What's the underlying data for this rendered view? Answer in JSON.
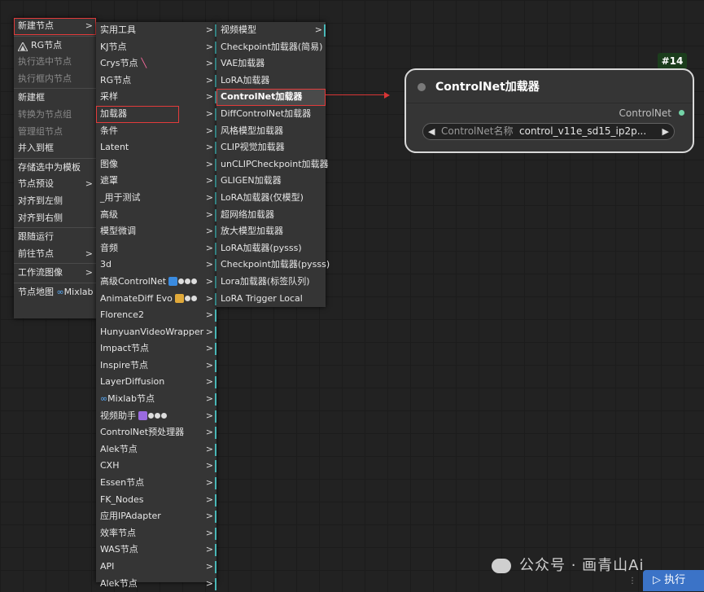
{
  "menu1": {
    "items": [
      {
        "label": "新建节点",
        "disabled": false,
        "arrow": true
      },
      {
        "label": "RG节点",
        "disabled": false,
        "arrow": false,
        "icon": "rg-triangle-icon"
      },
      {
        "label": "执行选中节点",
        "disabled": true,
        "arrow": false
      },
      {
        "label": "执行框内节点",
        "disabled": true,
        "arrow": false
      },
      {
        "label": "新建框",
        "disabled": false,
        "arrow": false
      },
      {
        "label": "转换为节点组",
        "disabled": true,
        "arrow": false
      },
      {
        "label": "管理组节点",
        "disabled": true,
        "arrow": false
      },
      {
        "label": "并入到框",
        "disabled": false,
        "arrow": false
      },
      {
        "label": "存储选中为模板",
        "disabled": false,
        "arrow": false
      },
      {
        "label": "节点预设",
        "disabled": false,
        "arrow": true
      },
      {
        "label": "对齐到左侧",
        "disabled": false,
        "arrow": false
      },
      {
        "label": "对齐到右侧",
        "disabled": false,
        "arrow": false
      },
      {
        "label": "跟随运行",
        "disabled": false,
        "arrow": false
      },
      {
        "label": "前往节点",
        "disabled": false,
        "arrow": true
      },
      {
        "label": "工作流图像",
        "disabled": false,
        "arrow": true
      },
      {
        "label": "节点地图",
        "disabled": false,
        "arrow": false,
        "suffix": "Mixlab"
      }
    ]
  },
  "menu2": {
    "items": [
      "实用工具",
      "KJ节点",
      "Crys节点",
      "RG节点",
      "采样",
      "加载器",
      "条件",
      "Latent",
      "图像",
      "遮罩",
      "_用于测试",
      "高级",
      "模型微调",
      "音频",
      "3d",
      "高级ControlNet",
      "AnimateDiff Evo",
      "Florence2",
      "HunyuanVideoWrapper",
      "Impact节点",
      "Inspire节点",
      "LayerDiffusion",
      "Mixlab节点",
      "视频助手",
      "ControlNet预处理器",
      "Alek节点",
      "CXH",
      "Essen节点",
      "FK_Nodes",
      "应用IPAdapter",
      "效率节点",
      "WAS节点",
      "API",
      "Alek节点"
    ]
  },
  "menu3": {
    "items": [
      "视频模型",
      "Checkpoint加载器(简易)",
      "VAE加载器",
      "LoRA加载器",
      "ControlNet加载器",
      "DiffControlNet加载器",
      "风格模型加载器",
      "CLIP视觉加载器",
      "unCLIPCheckpoint加载器",
      "GLIGEN加载器",
      "LoRA加载器(仅模型)",
      "超网络加载器",
      "放大模型加载器",
      "LoRA加载器(pysss)",
      "Checkpoint加载器(pysss)",
      "Lora加载器(标签队列)",
      "LoRA Trigger Local"
    ]
  },
  "node": {
    "id": "#14",
    "title": "ControlNet加载器",
    "output": "ControlNet",
    "widget_label": "ControlNet名称",
    "widget_value": "control_v11e_sd15_ip2p..."
  },
  "watermark": "公众号 · 画青山Ai",
  "run_button": "执行",
  "colors": {
    "accent_teal": "#49b7b7",
    "highlight_red": "#e23b3b",
    "node_id_bg": "#1b3d1c",
    "run_blue": "#3b73c7"
  }
}
